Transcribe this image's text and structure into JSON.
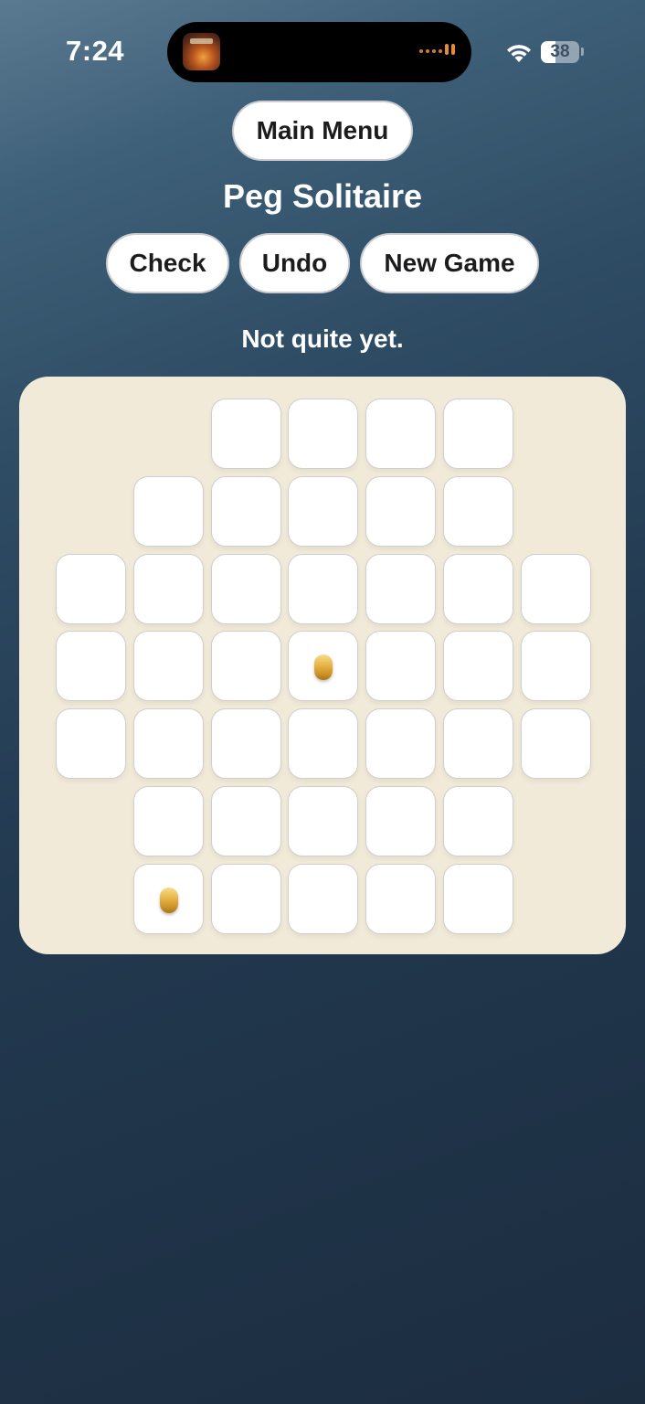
{
  "status_bar": {
    "time": "7:24",
    "battery": "38",
    "battery_level": 0.38,
    "icons": [
      "app-artwork-icon",
      "wifi-icon",
      "battery-icon"
    ]
  },
  "header": {
    "main_menu_label": "Main Menu",
    "title": "Peg Solitaire",
    "check_label": "Check",
    "undo_label": "Undo",
    "new_game_label": "New Game"
  },
  "message": "Not quite yet.",
  "board": {
    "rows": [
      [
        "x",
        "x",
        "h",
        "h",
        "h",
        "h",
        "x"
      ],
      [
        "x",
        "o",
        "o",
        "o",
        "o",
        "o",
        "x"
      ],
      [
        "o",
        "o",
        "o",
        "o",
        "o",
        "o",
        "o"
      ],
      [
        "o",
        "o",
        "o",
        "p",
        "o",
        "o",
        "o"
      ],
      [
        "o",
        "o",
        "o",
        "o",
        "o",
        "o",
        "o"
      ],
      [
        "x",
        "o",
        "o",
        "o",
        "o",
        "o",
        "x"
      ],
      [
        "x",
        "p",
        "o",
        "o",
        "o",
        "o",
        "x"
      ]
    ],
    "legend": {
      "x": "no hole",
      "o": "empty hole",
      "p": "peg",
      "h": "empty hole"
    },
    "peg_color": "#e2ac3d",
    "board_color": "#f2ead8"
  }
}
